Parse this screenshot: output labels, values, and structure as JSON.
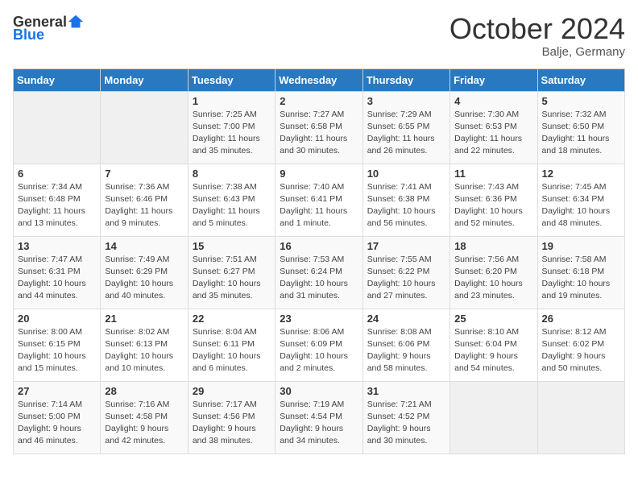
{
  "header": {
    "logo_general": "General",
    "logo_blue": "Blue",
    "month_title": "October 2024",
    "location": "Balje, Germany"
  },
  "weekdays": [
    "Sunday",
    "Monday",
    "Tuesday",
    "Wednesday",
    "Thursday",
    "Friday",
    "Saturday"
  ],
  "weeks": [
    [
      {
        "day": "",
        "sunrise": "",
        "sunset": "",
        "daylight": ""
      },
      {
        "day": "",
        "sunrise": "",
        "sunset": "",
        "daylight": ""
      },
      {
        "day": "1",
        "sunrise": "Sunrise: 7:25 AM",
        "sunset": "Sunset: 7:00 PM",
        "daylight": "Daylight: 11 hours and 35 minutes."
      },
      {
        "day": "2",
        "sunrise": "Sunrise: 7:27 AM",
        "sunset": "Sunset: 6:58 PM",
        "daylight": "Daylight: 11 hours and 30 minutes."
      },
      {
        "day": "3",
        "sunrise": "Sunrise: 7:29 AM",
        "sunset": "Sunset: 6:55 PM",
        "daylight": "Daylight: 11 hours and 26 minutes."
      },
      {
        "day": "4",
        "sunrise": "Sunrise: 7:30 AM",
        "sunset": "Sunset: 6:53 PM",
        "daylight": "Daylight: 11 hours and 22 minutes."
      },
      {
        "day": "5",
        "sunrise": "Sunrise: 7:32 AM",
        "sunset": "Sunset: 6:50 PM",
        "daylight": "Daylight: 11 hours and 18 minutes."
      }
    ],
    [
      {
        "day": "6",
        "sunrise": "Sunrise: 7:34 AM",
        "sunset": "Sunset: 6:48 PM",
        "daylight": "Daylight: 11 hours and 13 minutes."
      },
      {
        "day": "7",
        "sunrise": "Sunrise: 7:36 AM",
        "sunset": "Sunset: 6:46 PM",
        "daylight": "Daylight: 11 hours and 9 minutes."
      },
      {
        "day": "8",
        "sunrise": "Sunrise: 7:38 AM",
        "sunset": "Sunset: 6:43 PM",
        "daylight": "Daylight: 11 hours and 5 minutes."
      },
      {
        "day": "9",
        "sunrise": "Sunrise: 7:40 AM",
        "sunset": "Sunset: 6:41 PM",
        "daylight": "Daylight: 11 hours and 1 minute."
      },
      {
        "day": "10",
        "sunrise": "Sunrise: 7:41 AM",
        "sunset": "Sunset: 6:38 PM",
        "daylight": "Daylight: 10 hours and 56 minutes."
      },
      {
        "day": "11",
        "sunrise": "Sunrise: 7:43 AM",
        "sunset": "Sunset: 6:36 PM",
        "daylight": "Daylight: 10 hours and 52 minutes."
      },
      {
        "day": "12",
        "sunrise": "Sunrise: 7:45 AM",
        "sunset": "Sunset: 6:34 PM",
        "daylight": "Daylight: 10 hours and 48 minutes."
      }
    ],
    [
      {
        "day": "13",
        "sunrise": "Sunrise: 7:47 AM",
        "sunset": "Sunset: 6:31 PM",
        "daylight": "Daylight: 10 hours and 44 minutes."
      },
      {
        "day": "14",
        "sunrise": "Sunrise: 7:49 AM",
        "sunset": "Sunset: 6:29 PM",
        "daylight": "Daylight: 10 hours and 40 minutes."
      },
      {
        "day": "15",
        "sunrise": "Sunrise: 7:51 AM",
        "sunset": "Sunset: 6:27 PM",
        "daylight": "Daylight: 10 hours and 35 minutes."
      },
      {
        "day": "16",
        "sunrise": "Sunrise: 7:53 AM",
        "sunset": "Sunset: 6:24 PM",
        "daylight": "Daylight: 10 hours and 31 minutes."
      },
      {
        "day": "17",
        "sunrise": "Sunrise: 7:55 AM",
        "sunset": "Sunset: 6:22 PM",
        "daylight": "Daylight: 10 hours and 27 minutes."
      },
      {
        "day": "18",
        "sunrise": "Sunrise: 7:56 AM",
        "sunset": "Sunset: 6:20 PM",
        "daylight": "Daylight: 10 hours and 23 minutes."
      },
      {
        "day": "19",
        "sunrise": "Sunrise: 7:58 AM",
        "sunset": "Sunset: 6:18 PM",
        "daylight": "Daylight: 10 hours and 19 minutes."
      }
    ],
    [
      {
        "day": "20",
        "sunrise": "Sunrise: 8:00 AM",
        "sunset": "Sunset: 6:15 PM",
        "daylight": "Daylight: 10 hours and 15 minutes."
      },
      {
        "day": "21",
        "sunrise": "Sunrise: 8:02 AM",
        "sunset": "Sunset: 6:13 PM",
        "daylight": "Daylight: 10 hours and 10 minutes."
      },
      {
        "day": "22",
        "sunrise": "Sunrise: 8:04 AM",
        "sunset": "Sunset: 6:11 PM",
        "daylight": "Daylight: 10 hours and 6 minutes."
      },
      {
        "day": "23",
        "sunrise": "Sunrise: 8:06 AM",
        "sunset": "Sunset: 6:09 PM",
        "daylight": "Daylight: 10 hours and 2 minutes."
      },
      {
        "day": "24",
        "sunrise": "Sunrise: 8:08 AM",
        "sunset": "Sunset: 6:06 PM",
        "daylight": "Daylight: 9 hours and 58 minutes."
      },
      {
        "day": "25",
        "sunrise": "Sunrise: 8:10 AM",
        "sunset": "Sunset: 6:04 PM",
        "daylight": "Daylight: 9 hours and 54 minutes."
      },
      {
        "day": "26",
        "sunrise": "Sunrise: 8:12 AM",
        "sunset": "Sunset: 6:02 PM",
        "daylight": "Daylight: 9 hours and 50 minutes."
      }
    ],
    [
      {
        "day": "27",
        "sunrise": "Sunrise: 7:14 AM",
        "sunset": "Sunset: 5:00 PM",
        "daylight": "Daylight: 9 hours and 46 minutes."
      },
      {
        "day": "28",
        "sunrise": "Sunrise: 7:16 AM",
        "sunset": "Sunset: 4:58 PM",
        "daylight": "Daylight: 9 hours and 42 minutes."
      },
      {
        "day": "29",
        "sunrise": "Sunrise: 7:17 AM",
        "sunset": "Sunset: 4:56 PM",
        "daylight": "Daylight: 9 hours and 38 minutes."
      },
      {
        "day": "30",
        "sunrise": "Sunrise: 7:19 AM",
        "sunset": "Sunset: 4:54 PM",
        "daylight": "Daylight: 9 hours and 34 minutes."
      },
      {
        "day": "31",
        "sunrise": "Sunrise: 7:21 AM",
        "sunset": "Sunset: 4:52 PM",
        "daylight": "Daylight: 9 hours and 30 minutes."
      },
      {
        "day": "",
        "sunrise": "",
        "sunset": "",
        "daylight": ""
      },
      {
        "day": "",
        "sunrise": "",
        "sunset": "",
        "daylight": ""
      }
    ]
  ]
}
